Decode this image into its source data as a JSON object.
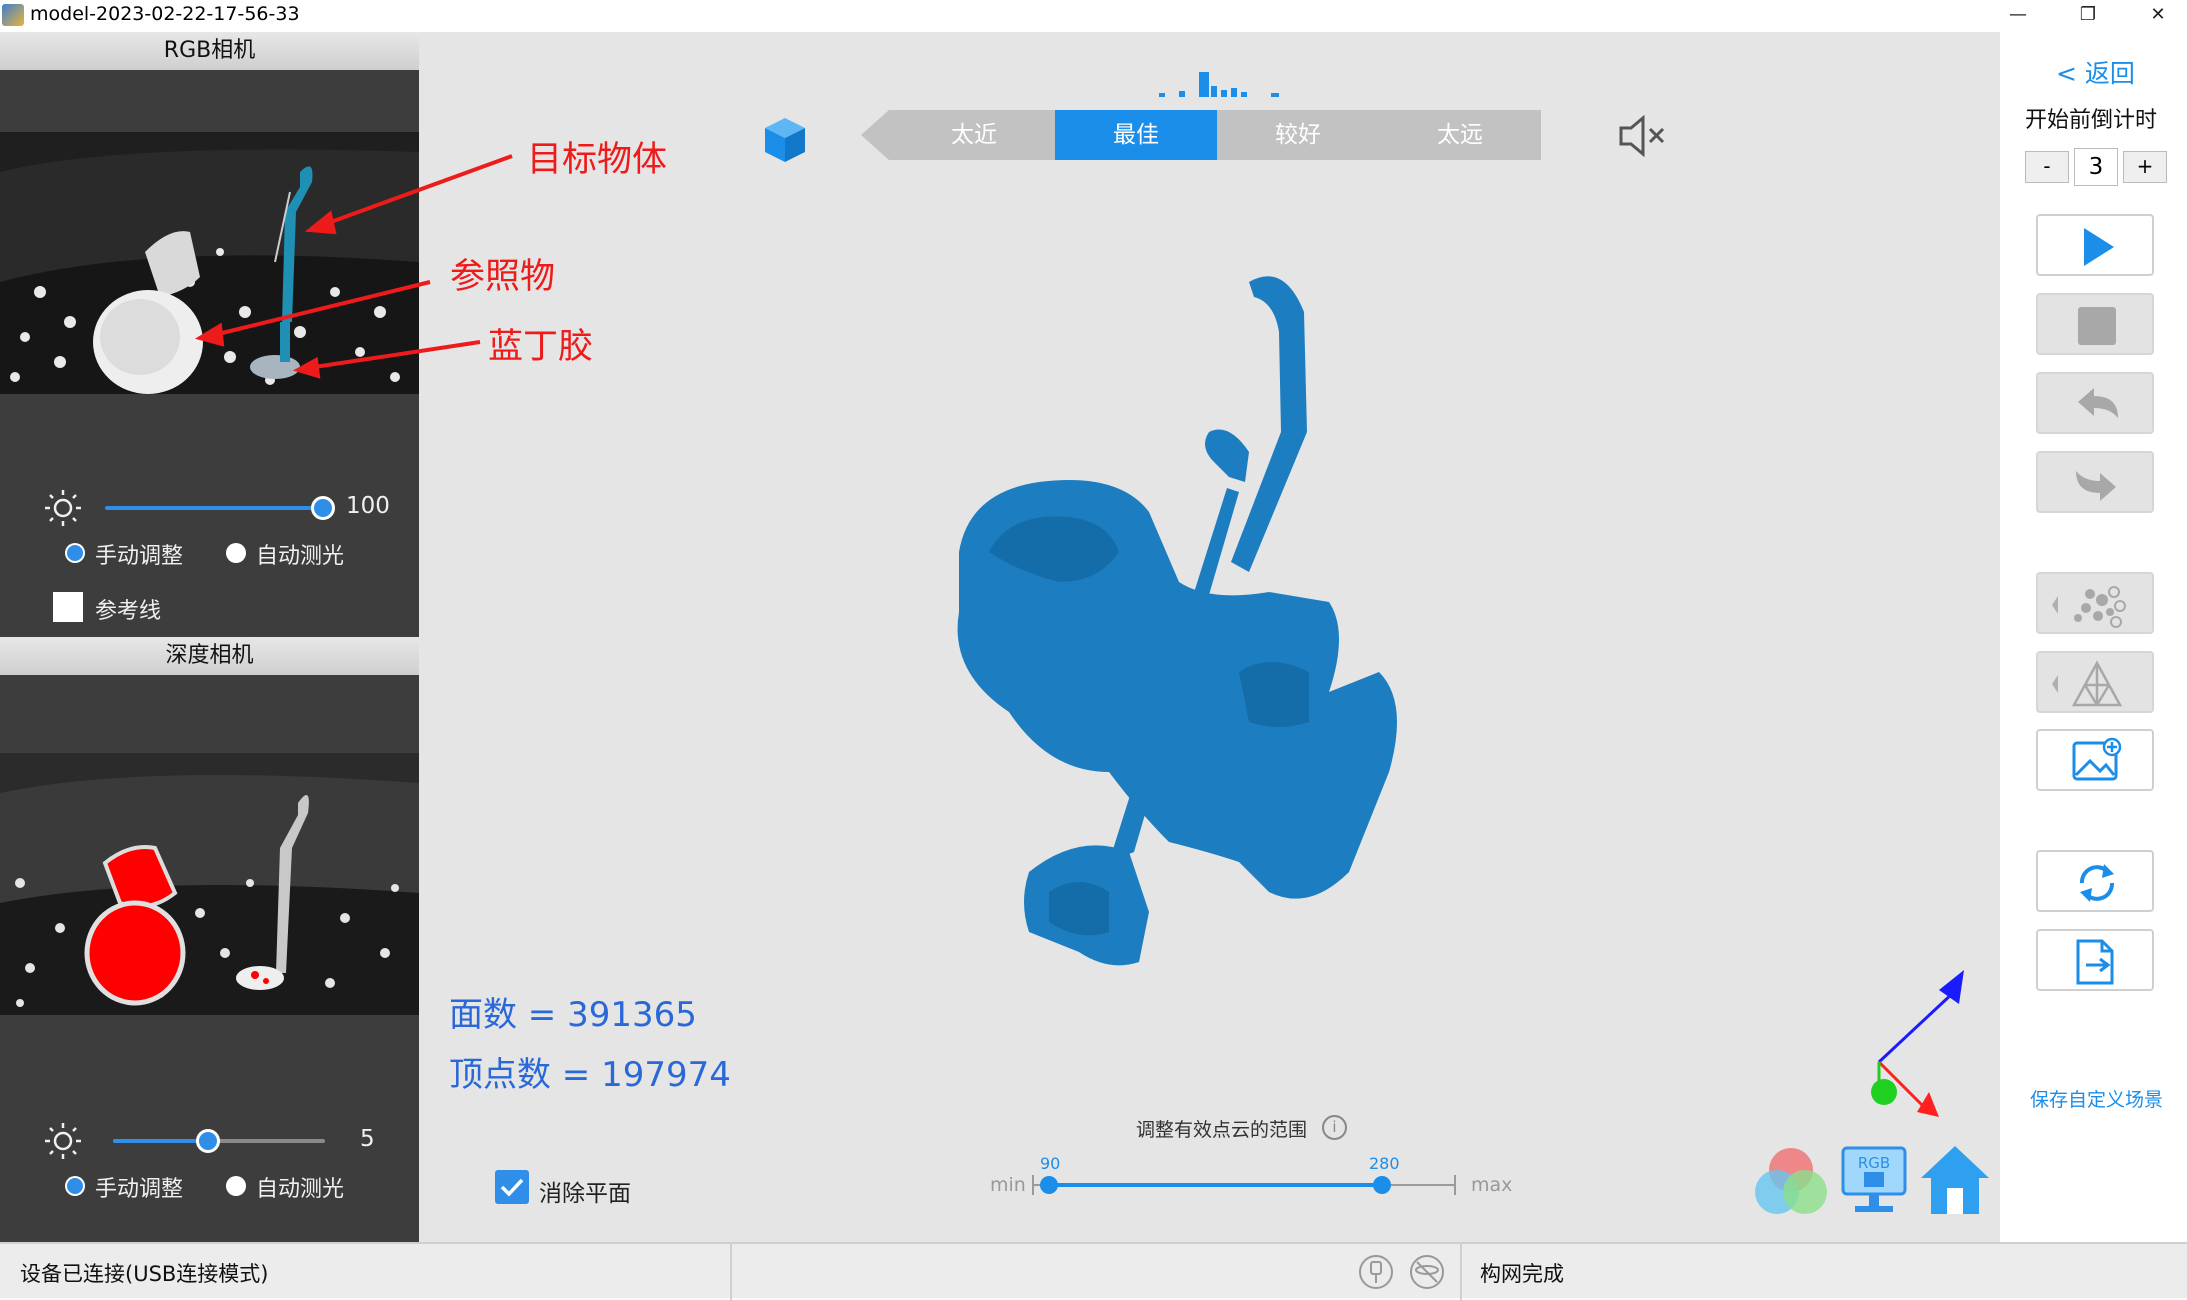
{
  "window": {
    "title": "model-2023-02-22-17-56-33",
    "minimize": "—",
    "restore": "❐",
    "close": "✕"
  },
  "rgb_camera": {
    "header": "RGB相机",
    "brightness_value": "100",
    "brightness_level": 1.0,
    "mode_manual": "手动调整",
    "mode_auto": "自动测光",
    "mode_selected": "manual",
    "guide_line_label": "参考线",
    "guide_line_checked": false
  },
  "depth_camera": {
    "header": "深度相机",
    "brightness_value": "5",
    "brightness_level": 0.45,
    "mode_manual": "手动调整",
    "mode_auto": "自动测光",
    "mode_selected": "manual"
  },
  "annotations": {
    "target": "目标物体",
    "reference": "参照物",
    "blu_tack": "蓝丁胶"
  },
  "distance": {
    "segments": [
      "太近",
      "最佳",
      "较好",
      "太远"
    ],
    "active_index": 1
  },
  "stats": {
    "faces_label": "面数",
    "faces_value": "391365",
    "vertices_label": "顶点数",
    "vertices_value": "197974"
  },
  "remove_plane": {
    "label": "消除平面",
    "checked": true
  },
  "point_cloud_range": {
    "label": "调整有效点云的范围",
    "min_label": "min",
    "max_label": "max",
    "low": "90",
    "high": "280"
  },
  "right_panel": {
    "back_label": "< 返回",
    "countdown_label": "开始前倒计时",
    "countdown_value": "3",
    "minus": "-",
    "plus": "+",
    "save_scene_label": "保存自定义场景"
  },
  "status": {
    "connection": "设备已连接(USB连接模式)",
    "mesh": "构网完成"
  },
  "colors": {
    "accent": "#1b8eea",
    "model": "#1c7ec0",
    "annot": "#ee1b1b"
  }
}
